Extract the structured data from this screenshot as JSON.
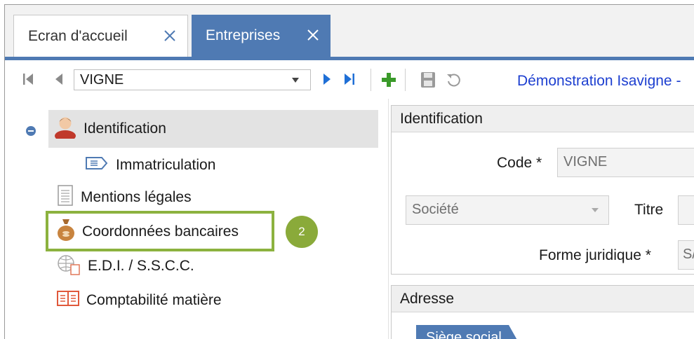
{
  "tabs": {
    "home_label": "Ecran d'accueil",
    "entreprises_label": "Entreprises"
  },
  "toolbar": {
    "record_value": "VIGNE",
    "company_link": "Démonstration Isavigne -"
  },
  "tree": {
    "identification": "Identification",
    "immatriculation": "Immatriculation",
    "mentions": "Mentions légales",
    "coordonnees": "Coordonnées bancaires",
    "edi": "E.D.I. / S.S.C.C.",
    "comptabilite": "Comptabilité matière",
    "badge": "2"
  },
  "identification_panel": {
    "title": "Identification",
    "code_label": "Code *",
    "code_value": "VIGNE",
    "type_value": "Société",
    "titre_label": "Titre",
    "forme_label": "Forme juridique *",
    "forme_value": "S/"
  },
  "adresse_panel": {
    "title": "Adresse",
    "subtab": "Siège social"
  },
  "colors": {
    "accent": "#4f7ab3",
    "highlight": "#8cb23f",
    "link": "#1d3fd0",
    "add_green": "#3a9a2a"
  }
}
